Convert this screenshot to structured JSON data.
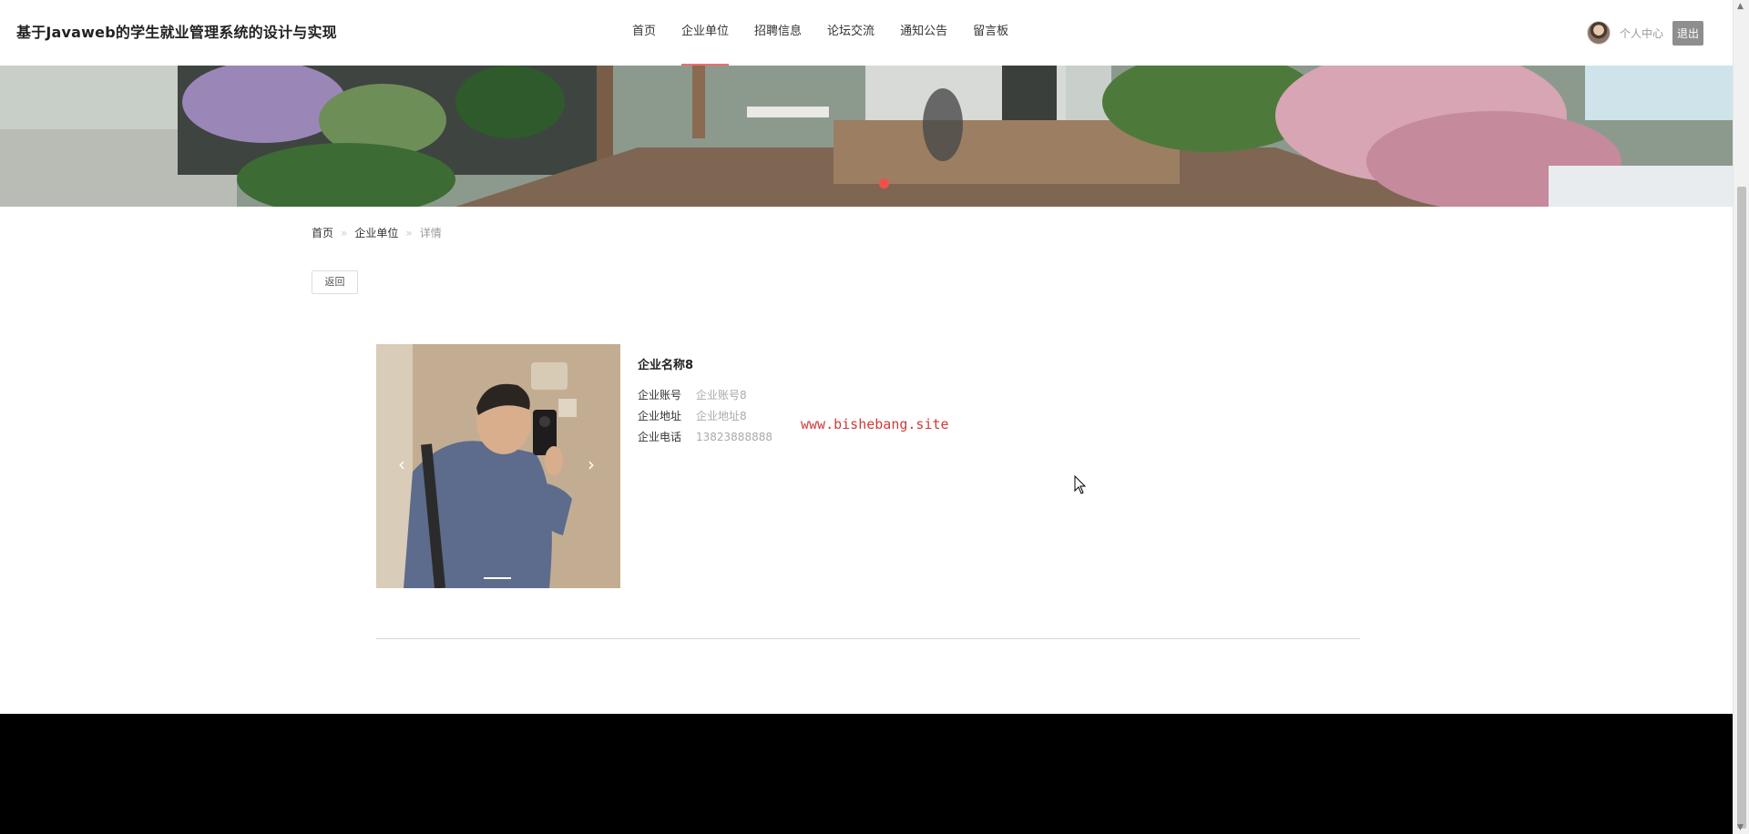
{
  "header": {
    "site_title": "基于Javaweb的学生就业管理系统的设计与实现",
    "nav": [
      {
        "label": "首页",
        "active": false
      },
      {
        "label": "企业单位",
        "active": true
      },
      {
        "label": "招聘信息",
        "active": false
      },
      {
        "label": "论坛交流",
        "active": false
      },
      {
        "label": "通知公告",
        "active": false
      },
      {
        "label": "留言板",
        "active": false
      }
    ],
    "user_center": "个人中心",
    "logout": "退出"
  },
  "breadcrumb": {
    "home": "首页",
    "section": "企业单位",
    "current": "详情",
    "separator": "»"
  },
  "back_button": "返回",
  "company": {
    "name": "企业名称8",
    "fields": [
      {
        "label": "企业账号",
        "value": "企业账号8"
      },
      {
        "label": "企业地址",
        "value": "企业地址8"
      },
      {
        "label": "企业电话",
        "value": "13823888888"
      }
    ]
  },
  "watermark": "www.bishebang.site",
  "carousel": {
    "prev_icon": "‹",
    "next_icon": "›"
  },
  "colors": {
    "accent": "#f26b6b",
    "watermark": "#d23a3a",
    "footer": "#000000"
  }
}
